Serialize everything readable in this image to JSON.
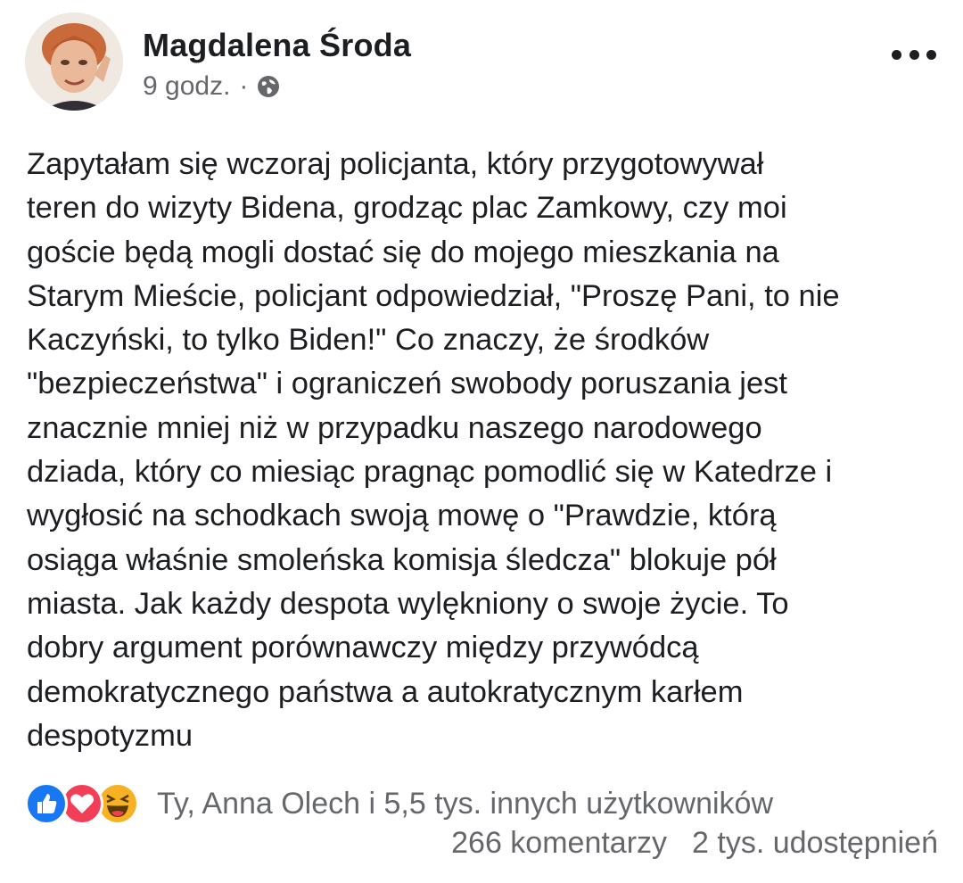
{
  "post": {
    "author": "Magdalena Środa",
    "time": "9 godz.",
    "separator": "·",
    "audience_icon": "globe-icon",
    "menu_icon": "more-options-icon",
    "text": "Zapytałam się wczoraj policjanta, który przygotowywał\nteren do wizyty Bidena, grodząc plac Zamkowy, czy moi\ngoście będą mogli dostać się do mojego mieszkania na\nStarym Mieście, policjant odpowiedział, \"Proszę Pani, to nie\nKaczyński, to tylko Biden!\" Co znaczy, że środków\n\"bezpieczeństwa\" i ograniczeń swobody poruszania jest\nznacznie mniej niż w przypadku naszego narodowego\ndziada, który co miesiąc pragnąc pomodlić się w Katedrze i\nwygłosić na schodkach swoją mowę o \"Prawdzie, którą\nosiąga właśnie smoleńska komisja śledcza\" blokuje pół\nmiasta. Jak każdy despota wylękniony o swoje życie. To\ndobry argument porównawczy między przywódcą\ndemokratycznego państwa a autokratycznym karłem\ndespotyzmu"
  },
  "reactions": {
    "icons": [
      "like-icon",
      "love-icon",
      "haha-icon"
    ],
    "names": "Ty, Anna Olech i 5,5 tys. innych użytkowników"
  },
  "stats": {
    "comments": "266 komentarzy",
    "shares": "2 tys. udostępnień"
  },
  "colors": {
    "like": "#1877f2",
    "love": "#f33e58",
    "haha": "#f7b125",
    "secondary_text": "#65676b"
  }
}
